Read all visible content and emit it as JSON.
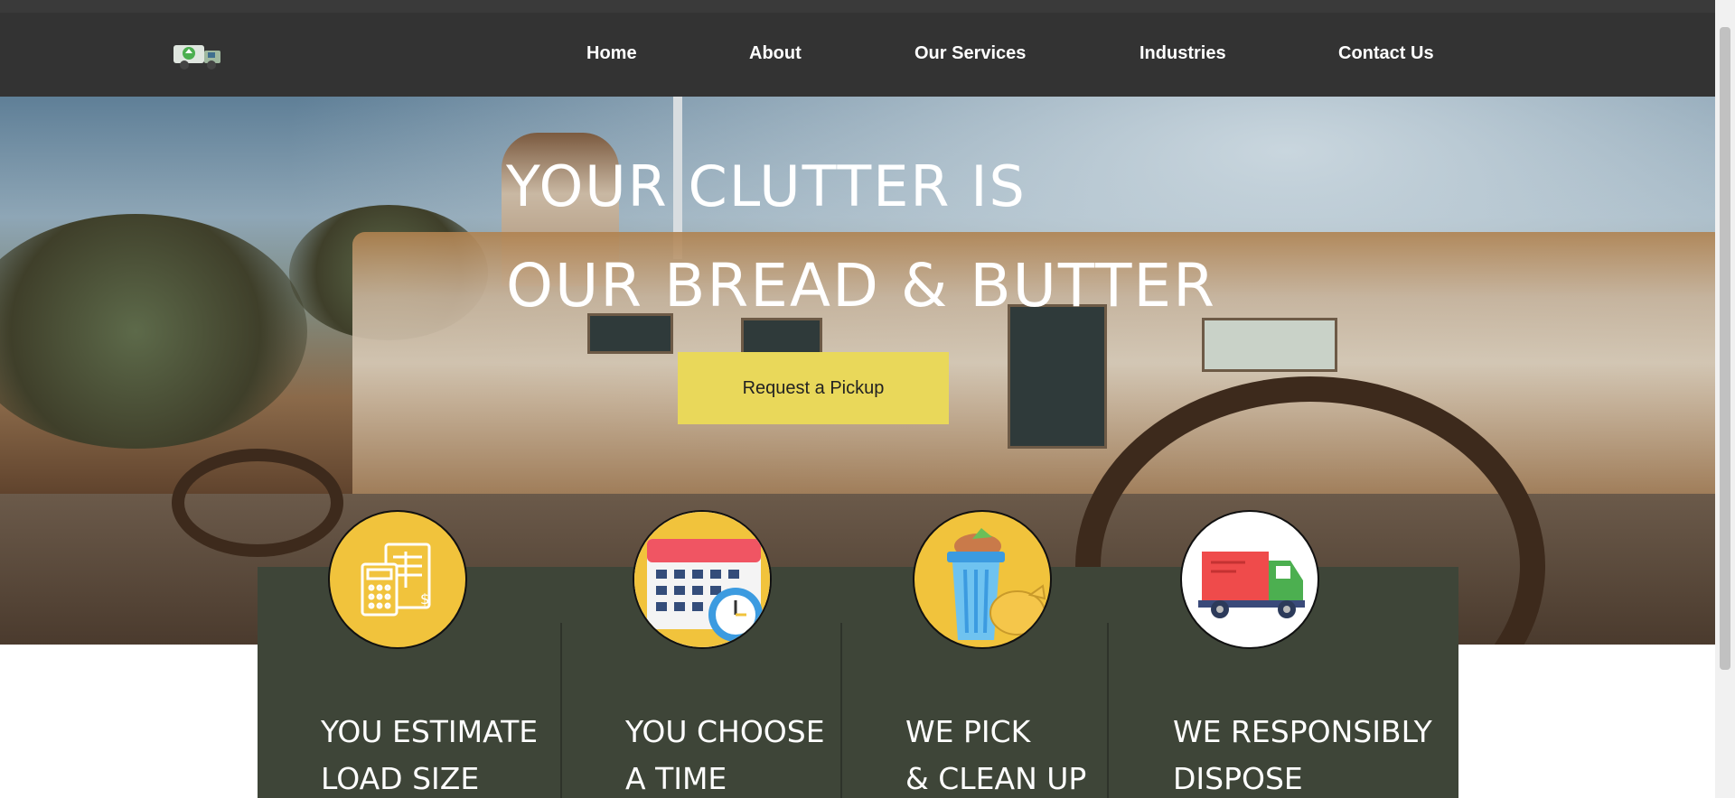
{
  "nav": {
    "logo_icon": "recycling-truck-icon",
    "items": [
      "Home",
      "About",
      "Our Services",
      "Industries",
      "Contact Us"
    ]
  },
  "hero": {
    "headline_line1": "YOUR CLUTTER IS",
    "headline_line2": "OUR BREAD & BUTTER",
    "cta_label": "Request a Pickup"
  },
  "steps": [
    {
      "icon": "calculator-invoice-icon",
      "line1": "YOU ESTIMATE",
      "line2": "LOAD SIZE"
    },
    {
      "icon": "calendar-clock-icon",
      "line1": "YOU CHOOSE",
      "line2": "A TIME"
    },
    {
      "icon": "trash-bin-icon",
      "line1": "WE PICK",
      "line2": "& CLEAN UP"
    },
    {
      "icon": "delivery-truck-icon",
      "line1": "WE RESPONSIBLY",
      "line2": "DISPOSE"
    }
  ],
  "colors": {
    "navbar": "#333333",
    "accent_yellow": "#e9d85a",
    "steps_panel": "#3e4538",
    "icon_circle_yellow": "#f1c33c"
  }
}
